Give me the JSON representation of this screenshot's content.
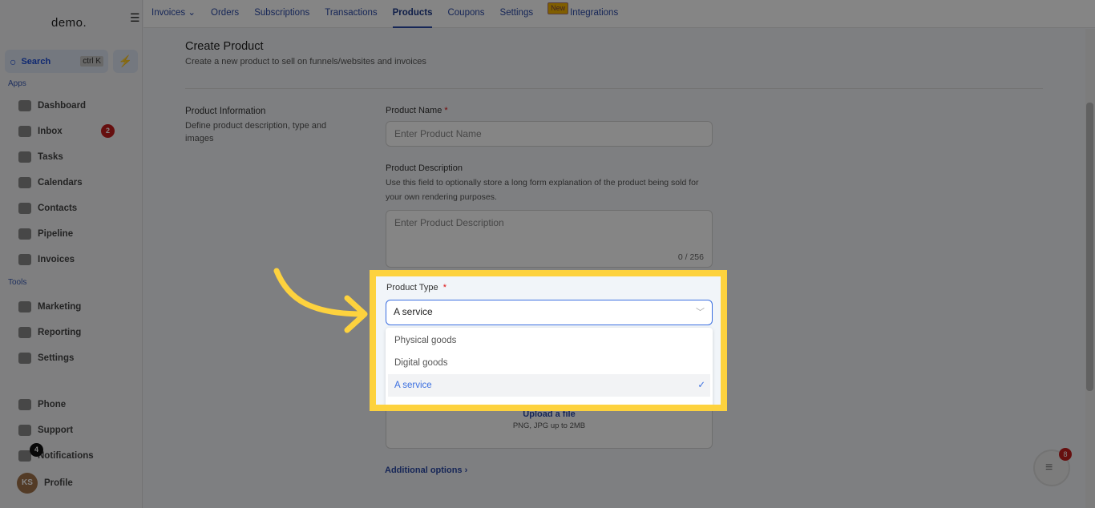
{
  "sidebar": {
    "logo": "demo.",
    "search_label": "Search",
    "search_shortcut": "ctrl K",
    "apps_section": "Apps",
    "tools_section": "Tools",
    "apps": [
      {
        "label": "Dashboard",
        "icon": "dashboard-icon"
      },
      {
        "label": "Inbox",
        "icon": "inbox-icon",
        "badge": "2"
      },
      {
        "label": "Tasks",
        "icon": "tasks-icon"
      },
      {
        "label": "Calendars",
        "icon": "calendar-icon"
      },
      {
        "label": "Contacts",
        "icon": "contacts-icon"
      },
      {
        "label": "Pipeline",
        "icon": "pipeline-icon"
      },
      {
        "label": "Invoices",
        "icon": "invoices-icon"
      }
    ],
    "tools": [
      {
        "label": "Marketing",
        "icon": "megaphone-icon"
      },
      {
        "label": "Reporting",
        "icon": "chart-icon"
      },
      {
        "label": "Settings",
        "icon": "gear-icon"
      }
    ],
    "bottom": [
      {
        "label": "Phone",
        "icon": "phone-icon"
      },
      {
        "label": "Support",
        "icon": "support-icon"
      },
      {
        "label": "Notifications",
        "icon": "bell-icon",
        "badge": "4"
      },
      {
        "label": "Profile",
        "avatar": "KS"
      }
    ]
  },
  "topnav": {
    "tabs": [
      "Invoices",
      "Orders",
      "Subscriptions",
      "Transactions",
      "Products",
      "Coupons",
      "Settings",
      "Integrations"
    ],
    "active": "Products",
    "new_badge": "New"
  },
  "page": {
    "title": "Create Product",
    "subtitle": "Create a new product to sell on funnels/websites and invoices",
    "section_title": "Product Information",
    "section_desc": "Define product description, type and images",
    "name_label": "Product Name",
    "name_placeholder": "Enter Product Name",
    "desc_label": "Product Description",
    "desc_help": "Use this field to optionally store a long form explanation of the product being sold for your own rendering purposes.",
    "desc_placeholder": "Enter Product Description",
    "desc_counter": "0 / 256",
    "type_label": "Product Type",
    "type_value": "A service",
    "required_mark": "*",
    "type_options": [
      "Physical goods",
      "Digital goods",
      "A service"
    ],
    "upload_label": "Upload a file",
    "upload_hint": "PNG, JPG up to 2MB",
    "additional_options": "Additional options"
  },
  "chat": {
    "badge": "8"
  },
  "colors": {
    "highlight": "#fdd23e",
    "accent": "#3b6fe0"
  }
}
